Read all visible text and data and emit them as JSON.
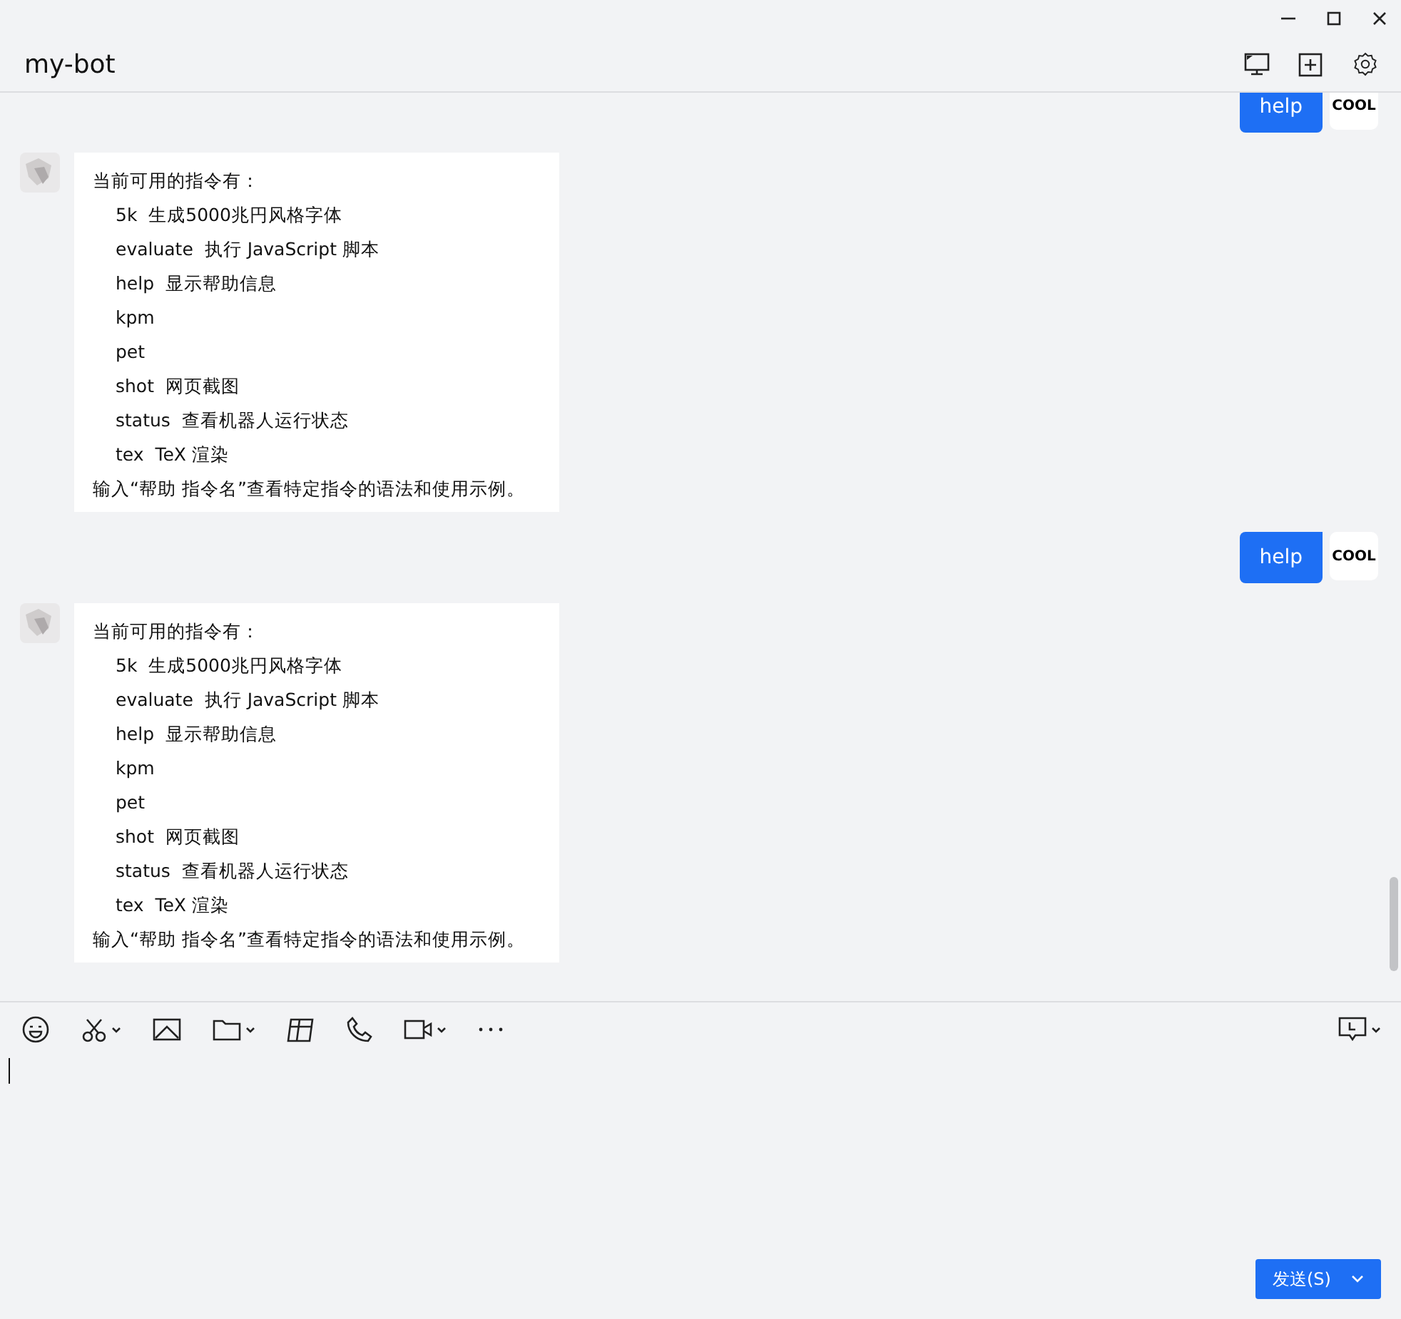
{
  "window": {
    "title": "my-bot"
  },
  "messages": [
    {
      "kind": "outgoing",
      "text": "help",
      "avatar_text": "COOL"
    },
    {
      "kind": "incoming",
      "lines": [
        {
          "text": "当前可用的指令有：",
          "indent": false
        },
        {
          "text": "5k  生成5000兆円风格字体",
          "indent": true
        },
        {
          "text": "evaluate  执行 JavaScript 脚本",
          "indent": true
        },
        {
          "text": "help  显示帮助信息",
          "indent": true
        },
        {
          "text": "kpm",
          "indent": true
        },
        {
          "text": "pet",
          "indent": true
        },
        {
          "text": "shot  网页截图",
          "indent": true
        },
        {
          "text": "status  查看机器人运行状态",
          "indent": true
        },
        {
          "text": "tex  TeX 渲染",
          "indent": true
        },
        {
          "text": "输入“帮助 指令名”查看特定指令的语法和使用示例。",
          "indent": false
        }
      ]
    },
    {
      "kind": "outgoing",
      "text": "help",
      "avatar_text": "COOL"
    },
    {
      "kind": "incoming",
      "lines": [
        {
          "text": "当前可用的指令有：",
          "indent": false
        },
        {
          "text": "5k  生成5000兆円风格字体",
          "indent": true
        },
        {
          "text": "evaluate  执行 JavaScript 脚本",
          "indent": true
        },
        {
          "text": "help  显示帮助信息",
          "indent": true
        },
        {
          "text": "kpm",
          "indent": true
        },
        {
          "text": "pet",
          "indent": true
        },
        {
          "text": "shot  网页截图",
          "indent": true
        },
        {
          "text": "status  查看机器人运行状态",
          "indent": true
        },
        {
          "text": "tex  TeX 渲染",
          "indent": true
        },
        {
          "text": "输入“帮助 指令名”查看特定指令的语法和使用示例。",
          "indent": false
        }
      ]
    }
  ],
  "send_button": {
    "label": "发送(S)"
  }
}
